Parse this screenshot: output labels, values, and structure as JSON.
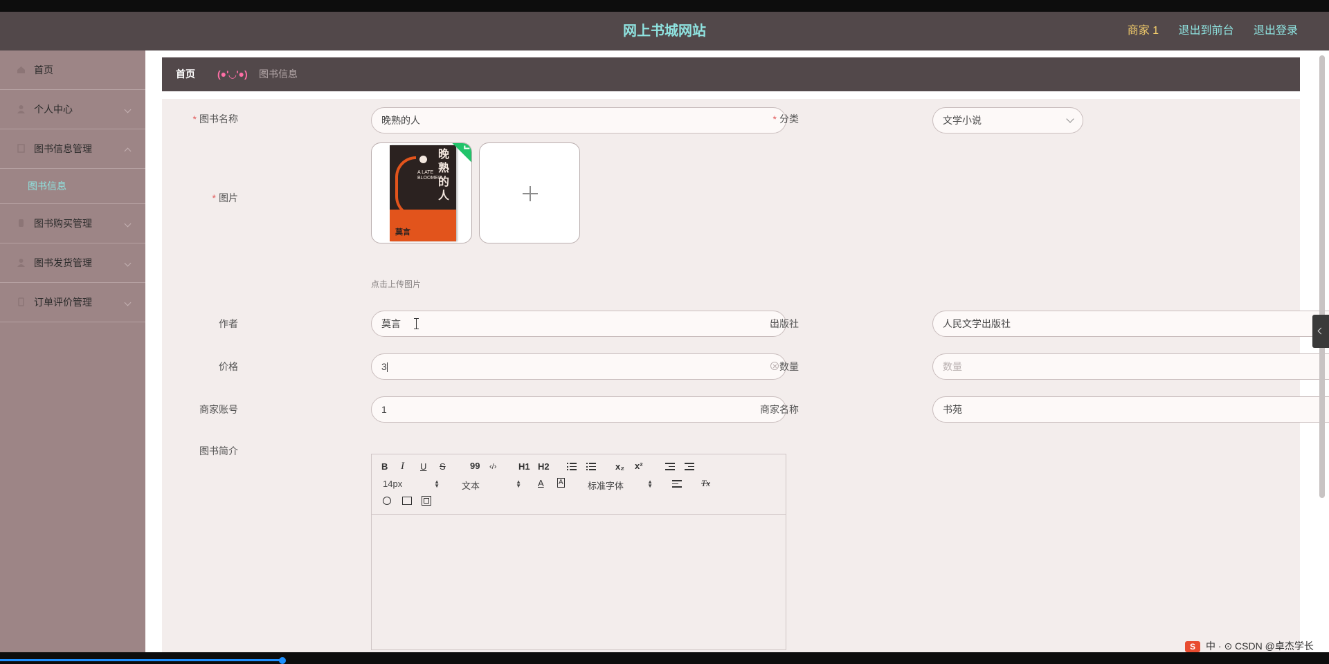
{
  "header": {
    "title": "网上书城网站",
    "merchant": "商家 1",
    "link_front": "退出到前台",
    "link_logout": "退出登录"
  },
  "sidebar": {
    "items": [
      {
        "label": "首页"
      },
      {
        "label": "个人中心"
      },
      {
        "label": "图书信息管理"
      },
      {
        "label": "图书购买管理"
      },
      {
        "label": "图书发货管理"
      },
      {
        "label": "订单评价管理"
      }
    ],
    "sub_item": "图书信息"
  },
  "breadcrumb": {
    "home": "首页",
    "separator": "(●'◡'●)",
    "current": "图书信息"
  },
  "form": {
    "name_label": "图书名称",
    "name_value": "晚熟的人",
    "category_label": "分类",
    "category_value": "文学小说",
    "image_label": "图片",
    "upload_hint": "点击上传图片",
    "author_label": "作者",
    "author_value": "莫言",
    "publisher_label": "出版社",
    "publisher_value": "人民文学出版社",
    "price_label": "价格",
    "price_value": "3",
    "quantity_label": "数量",
    "quantity_placeholder": "数量",
    "merchant_account_label": "商家账号",
    "merchant_account_value": "1",
    "merchant_name_label": "商家名称",
    "merchant_name_value": "书苑",
    "intro_label": "图书简介"
  },
  "book_cover": {
    "title": "晚熟的人",
    "english": "A LATE BLOOMER",
    "author": "莫言"
  },
  "editor": {
    "font_size": "14px",
    "heading": "文本",
    "font_family": "标准字体",
    "bold": "B",
    "italic": "I",
    "underline": "U",
    "strike": "S",
    "quote": "99",
    "code": "‹/›",
    "h1": "H1",
    "h2": "H2",
    "sub": "x₂",
    "sup": "x²",
    "clean": "Tx",
    "color": "A"
  },
  "footer": {
    "watermark": "中 · ⊙ CSDN @卓杰学长"
  },
  "colors": {
    "header_bg": "#52484a",
    "sidebar_bg": "#9d8586",
    "accent": "#8fe3e0",
    "merchant": "#f2cc6b",
    "form_bg": "#f3edec"
  }
}
